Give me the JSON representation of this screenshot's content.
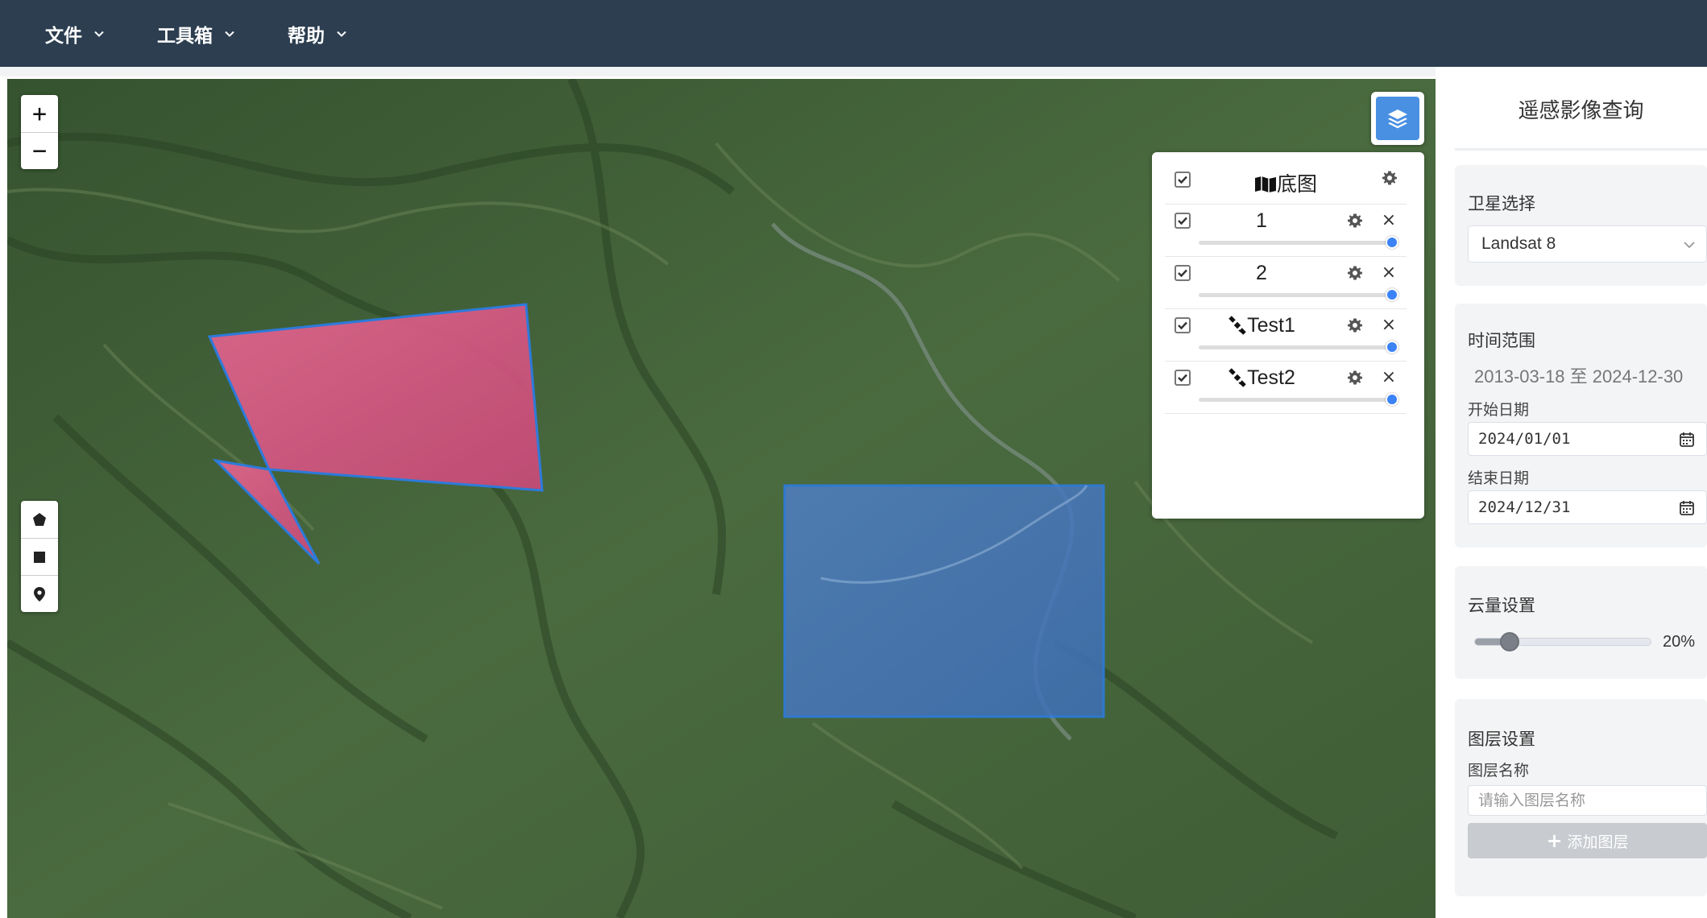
{
  "menu": [
    {
      "label": "文件"
    },
    {
      "label": "工具箱"
    },
    {
      "label": "帮助"
    }
  ],
  "map": {
    "zoom_in_label": "+",
    "zoom_out_label": "−",
    "draw_tools": [
      "polygon-icon",
      "rectangle-icon",
      "marker-icon"
    ],
    "footprint_colors": {
      "pink": "#e0507a",
      "blue": "#3a78d8",
      "outline": "#2b7de9"
    }
  },
  "layer_panel": {
    "layers": [
      {
        "name": "底图",
        "icon": "map-icon",
        "checked": true,
        "has_close": false,
        "opacity": null
      },
      {
        "name": "1",
        "icon": "",
        "checked": true,
        "has_close": true,
        "opacity": 1
      },
      {
        "name": "2",
        "icon": "",
        "checked": true,
        "has_close": true,
        "opacity": 1
      },
      {
        "name": "Test1",
        "icon": "satellite-icon",
        "checked": true,
        "has_close": true,
        "opacity": 1
      },
      {
        "name": "Test2",
        "icon": "satellite-icon",
        "checked": true,
        "has_close": true,
        "opacity": 1
      }
    ],
    "close_glyph": "×"
  },
  "side": {
    "title": "遥感影像查询",
    "satellite": {
      "title": "卫星选择",
      "selected": "Landsat 8"
    },
    "time": {
      "title": "时间范围",
      "range": "2013-03-18 至 2024-12-30",
      "start_label": "开始日期",
      "start_value": "2024/01/01",
      "end_label": "结束日期",
      "end_value": "2024/12/31"
    },
    "cloud": {
      "title": "云量设置",
      "value_label": "20%",
      "value": 0.2
    },
    "layer": {
      "title": "图层设置",
      "name_label": "图层名称",
      "name_placeholder": "请输入图层名称",
      "add_label": "添加图层",
      "add_icon": "+"
    }
  },
  "colors": {
    "topbar": "#2c3e50",
    "accent": "#4a90e2",
    "slider": "#3b82f6"
  }
}
